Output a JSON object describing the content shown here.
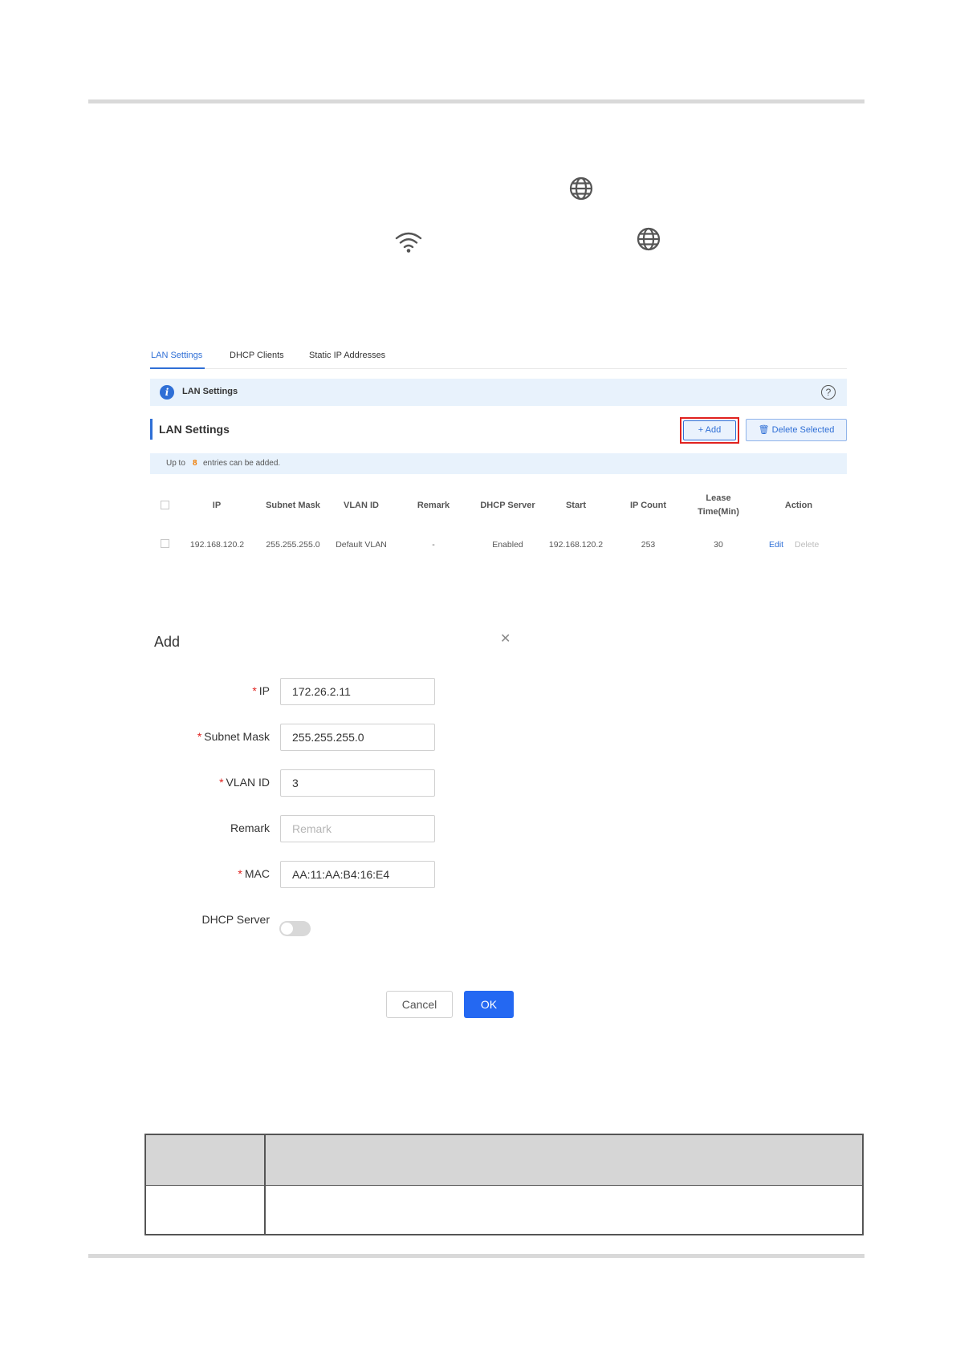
{
  "tabs": [
    {
      "label": "LAN Settings",
      "active": true
    },
    {
      "label": "DHCP Clients",
      "active": false
    },
    {
      "label": "Static IP Addresses",
      "active": false
    }
  ],
  "info_bar": {
    "title": "LAN Settings",
    "help_icon": "question-circle-icon"
  },
  "section": {
    "title": "LAN Settings"
  },
  "buttons": {
    "add": "+ Add",
    "delete_selected": "Delete Selected"
  },
  "notice": {
    "prefix": "Up to",
    "count": "8",
    "suffix": "entries can be added."
  },
  "table": {
    "headers": [
      "IP",
      "Subnet Mask",
      "VLAN ID",
      "Remark",
      "DHCP Server",
      "Start",
      "IP Count",
      "Lease",
      "Time(Min)",
      "Action"
    ],
    "row": {
      "ip": "192.168.120.2",
      "subnet": "255.255.255.0",
      "vlan": "Default VLAN",
      "remark": "-",
      "dhcp": "Enabled",
      "start": "192.168.120.2",
      "count": "253",
      "lease": "30",
      "edit": "Edit",
      "delete": "Delete"
    }
  },
  "dialog": {
    "title": "Add",
    "fields": {
      "ip": {
        "label": "IP",
        "value": "172.26.2.11"
      },
      "subnet": {
        "label": "Subnet Mask",
        "value": "255.255.255.0"
      },
      "vlan": {
        "label": "VLAN ID",
        "value": "3"
      },
      "remark": {
        "label": "Remark",
        "placeholder": "Remark"
      },
      "mac": {
        "label": "MAC",
        "value": "AA:11:AA:B4:16:E4"
      },
      "dhcp": {
        "label": "DHCP Server",
        "enabled": false
      }
    },
    "cancel": "Cancel",
    "ok": "OK"
  },
  "colors": {
    "accent": "#2f6fd6",
    "highlight": "#e0221f",
    "ok_button": "#2468f2"
  }
}
